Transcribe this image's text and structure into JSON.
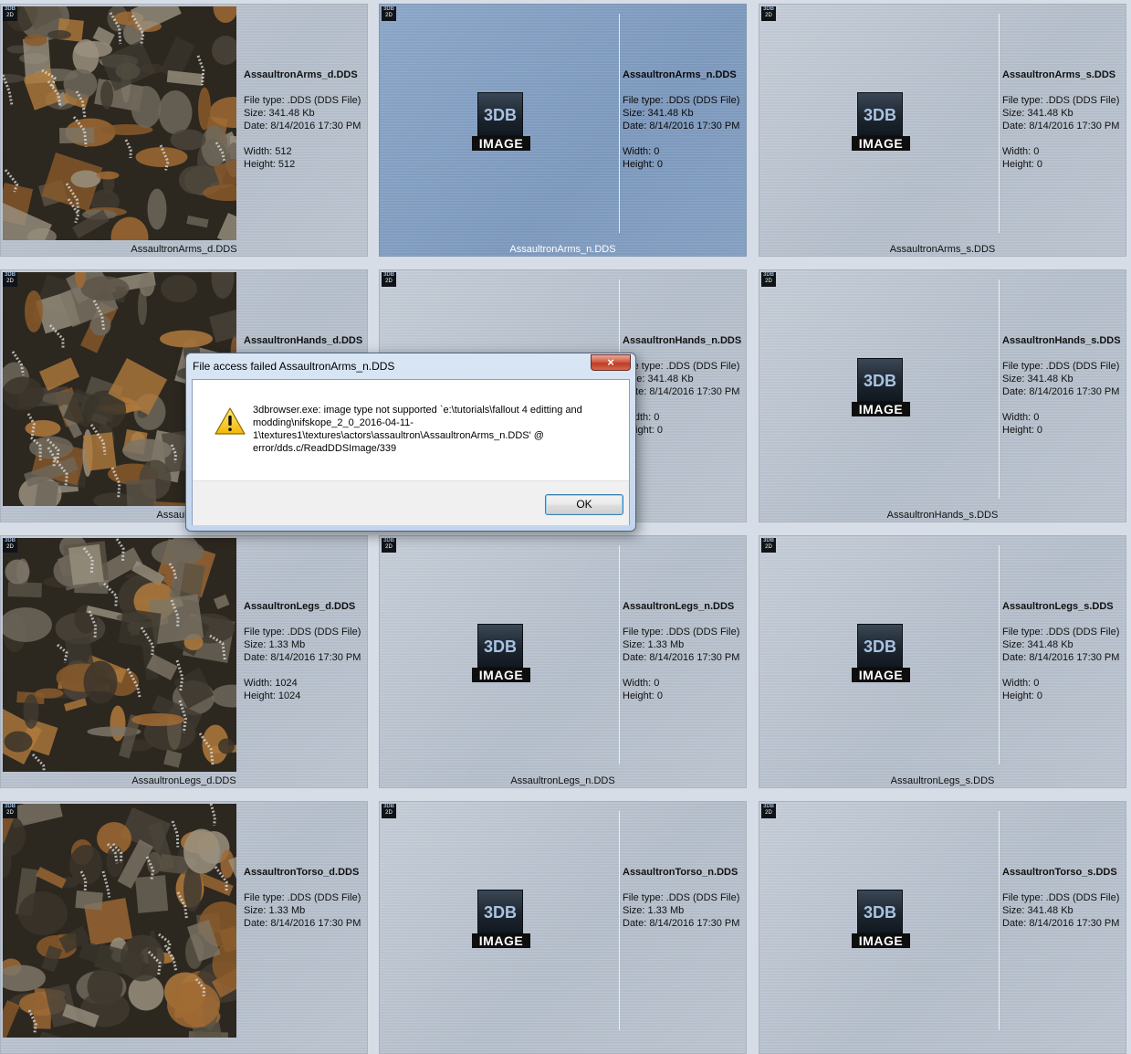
{
  "colors": {
    "tile_bg": "#b9c2ce",
    "tile_selected_bg": "#7f9cc0",
    "dialog_close": "#c9462e",
    "texture_dark": "#2d2820",
    "texture_rust": "#8a5a2a"
  },
  "tiles": [
    {
      "name": "AssaultronArms_d.DDS",
      "caption": "AssaultronArms_d.DDS",
      "file_type": "File type: .DDS (DDS File)",
      "size": "Size: 341.48 Kb",
      "date": "Date: 8/14/2016 17:30 PM",
      "width": "Width: 512",
      "height": "Height: 512",
      "preview": "texture",
      "selected": false
    },
    {
      "name": "AssaultronArms_n.DDS",
      "caption": "AssaultronArms_n.DDS",
      "file_type": "File type: .DDS (DDS File)",
      "size": "Size: 341.48 Kb",
      "date": "Date: 8/14/2016 17:30 PM",
      "width": "Width: 0",
      "height": "Height: 0",
      "preview": "placeholder",
      "selected": true
    },
    {
      "name": "AssaultronArms_s.DDS",
      "caption": "AssaultronArms_s.DDS",
      "file_type": "File type: .DDS (DDS File)",
      "size": "Size: 341.48 Kb",
      "date": "Date: 8/14/2016 17:30 PM",
      "width": "Width: 0",
      "height": "Height: 0",
      "preview": "placeholder",
      "selected": false
    },
    {
      "name": "AssaultronHands_d.DDS",
      "caption": "AssaultronH",
      "file_type": "",
      "size": "",
      "date": "",
      "width": "",
      "height": "",
      "preview": "texture",
      "selected": false
    },
    {
      "name": "AssaultronHands_n.DDS",
      "caption": "",
      "file_type": "File type: .DDS (DDS File)",
      "size": "Size: 341.48 Kb",
      "date": "Date: 8/14/2016 17:30 PM",
      "width": "Width: 0",
      "height": "Height: 0",
      "preview": "placeholder",
      "selected": false
    },
    {
      "name": "AssaultronHands_s.DDS",
      "caption": "AssaultronHands_s.DDS",
      "file_type": "File type: .DDS (DDS File)",
      "size": "Size: 341.48 Kb",
      "date": "Date: 8/14/2016 17:30 PM",
      "width": "Width: 0",
      "height": "Height: 0",
      "preview": "placeholder",
      "selected": false
    },
    {
      "name": "AssaultronLegs_d.DDS",
      "caption": "AssaultronLegs_d.DDS",
      "file_type": "File type: .DDS (DDS File)",
      "size": "Size: 1.33 Mb",
      "date": "Date: 8/14/2016 17:30 PM",
      "width": "Width: 1024",
      "height": "Height: 1024",
      "preview": "texture",
      "selected": false
    },
    {
      "name": "AssaultronLegs_n.DDS",
      "caption": "AssaultronLegs_n.DDS",
      "file_type": "File type: .DDS (DDS File)",
      "size": "Size: 1.33 Mb",
      "date": "Date: 8/14/2016 17:30 PM",
      "width": "Width: 0",
      "height": "Height: 0",
      "preview": "placeholder",
      "selected": false
    },
    {
      "name": "AssaultronLegs_s.DDS",
      "caption": "AssaultronLegs_s.DDS",
      "file_type": "File type: .DDS (DDS File)",
      "size": "Size: 341.48 Kb",
      "date": "Date: 8/14/2016 17:30 PM",
      "width": "Width: 0",
      "height": "Height: 0",
      "preview": "placeholder",
      "selected": false
    },
    {
      "name": "AssaultronTorso_d.DDS",
      "caption": "",
      "file_type": "File type: .DDS (DDS File)",
      "size": "Size: 1.33 Mb",
      "date": "Date: 8/14/2016 17:30 PM",
      "width": "",
      "height": "",
      "preview": "texture",
      "selected": false
    },
    {
      "name": "AssaultronTorso_n.DDS",
      "caption": "",
      "file_type": "File type: .DDS (DDS File)",
      "size": "Size: 1.33 Mb",
      "date": "Date: 8/14/2016 17:30 PM",
      "width": "",
      "height": "",
      "preview": "placeholder",
      "selected": false
    },
    {
      "name": "AssaultronTorso_s.DDS",
      "caption": "",
      "file_type": "File type: .DDS (DDS File)",
      "size": "Size: 341.48 Kb",
      "date": "Date: 8/14/2016 17:30 PM",
      "width": "",
      "height": "",
      "preview": "placeholder",
      "selected": false
    }
  ],
  "badge": {
    "line1": "3DB",
    "line2": "2D"
  },
  "placeholder": {
    "logo": "3DB",
    "label": "IMAGE"
  },
  "dialog": {
    "title": "File access failed AssaultronArms_n.DDS",
    "close_label": "×",
    "message": "3dbrowser.exe: image type not supported `e:\\tutorials\\fallout 4 editting and modding\\nifskope_2_0_2016-04-11-1\\textures1\\textures\\actors\\assaultron\\AssaultronArms_n.DDS' @ error/dds.c/ReadDDSImage/339",
    "ok_label": "OK",
    "icon": "warning-icon"
  }
}
